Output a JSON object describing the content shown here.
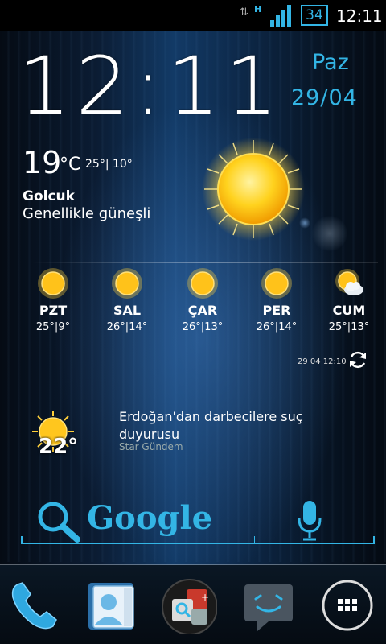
{
  "status_bar": {
    "network_type": "H",
    "battery": "34",
    "time": "12:11"
  },
  "clock": {
    "time": "12:11",
    "day": "Paz",
    "date": "29/04"
  },
  "weather": {
    "current_temp": "19",
    "unit": "°C",
    "range": "25°| 10°",
    "city": "Golcuk",
    "condition": "Genellikle güneşli",
    "forecast": [
      {
        "day": "PZT",
        "range": "25°|9°",
        "icon": "sun-icon"
      },
      {
        "day": "SAL",
        "range": "26°|14°",
        "icon": "sun-icon"
      },
      {
        "day": "ÇAR",
        "range": "26°|13°",
        "icon": "sun-icon"
      },
      {
        "day": "PER",
        "range": "26°|14°",
        "icon": "sun-icon"
      },
      {
        "day": "CUM",
        "range": "25°|13°",
        "icon": "partly-cloudy-icon"
      }
    ],
    "updated": "29 04 12:10"
  },
  "news": {
    "temp": "22°",
    "title": "Erdoğan'dan darbecilere suç duyurusu",
    "source": "Star Gündem"
  },
  "search": {
    "brand": "Google"
  },
  "dock": {
    "items": [
      "phone-icon",
      "contacts-icon",
      "app-folder-icon",
      "messaging-icon",
      "app-drawer-icon"
    ]
  },
  "colors": {
    "accent": "#33b5e5"
  }
}
